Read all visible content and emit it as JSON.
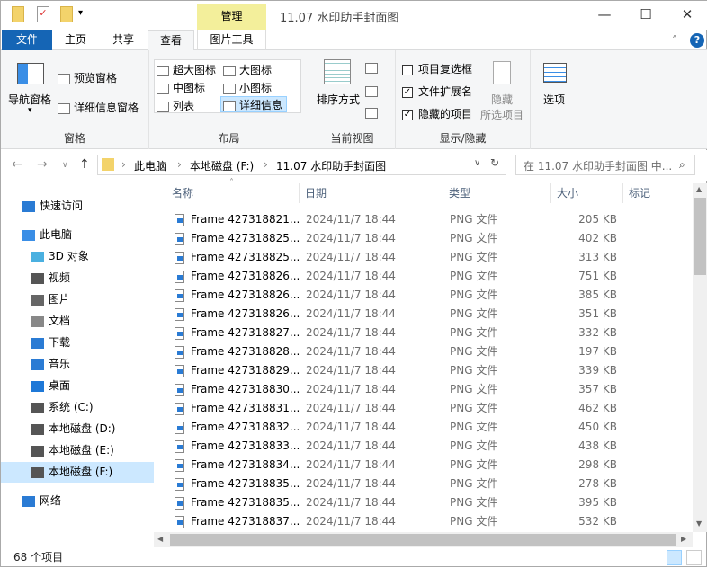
{
  "titlebar": {
    "title": "11.07 水印助手封面图",
    "context_tab": "管理",
    "minimize": "—",
    "maximize": "☐",
    "close": "✕"
  },
  "tabs": [
    {
      "label": "文件"
    },
    {
      "label": "主页"
    },
    {
      "label": "共享"
    },
    {
      "label": "查看"
    },
    {
      "label": "图片工具"
    }
  ],
  "ribbon": {
    "panes": {
      "nav_pane": "导航窗格",
      "preview": "预览窗格",
      "details": "详细信息窗格",
      "group": "窗格"
    },
    "layout": {
      "items": [
        "超大图标",
        "大图标",
        "中图标",
        "小图标",
        "列表",
        "详细信息"
      ],
      "group": "布局"
    },
    "view": {
      "sort": "排序方式",
      "group": "当前视图"
    },
    "show": {
      "item_checkbox": "项目复选框",
      "extensions": "文件扩展名",
      "hidden_items": "隐藏的项目",
      "hide_selected": "隐藏",
      "hide_selected2": "所选项目",
      "group": "显示/隐藏",
      "item_checkbox_checked": false,
      "extensions_checked": true,
      "hidden_checked": true
    },
    "options": "选项"
  },
  "address": {
    "crumbs": [
      "此电脑",
      "本地磁盘 (F:)",
      "11.07 水印助手封面图"
    ],
    "search_placeholder": "在 11.07 水印助手封面图 中..."
  },
  "sidebar": [
    {
      "label": "快速访问",
      "icon": "star-icon"
    },
    {
      "label": "此电脑",
      "icon": "computer-icon"
    },
    {
      "label": "3D 对象",
      "icon": "cube-icon"
    },
    {
      "label": "视频",
      "icon": "video-icon"
    },
    {
      "label": "图片",
      "icon": "picture-icon"
    },
    {
      "label": "文档",
      "icon": "document-icon"
    },
    {
      "label": "下载",
      "icon": "download-icon"
    },
    {
      "label": "音乐",
      "icon": "music-icon"
    },
    {
      "label": "桌面",
      "icon": "desktop-icon"
    },
    {
      "label": "系统 (C:)",
      "icon": "drive-icon"
    },
    {
      "label": "本地磁盘 (D:)",
      "icon": "drive-icon"
    },
    {
      "label": "本地磁盘 (E:)",
      "icon": "drive-icon"
    },
    {
      "label": "本地磁盘 (F:)",
      "icon": "drive-icon"
    },
    {
      "label": "网络",
      "icon": "network-icon"
    }
  ],
  "columns": [
    "名称",
    "日期",
    "类型",
    "大小",
    "标记"
  ],
  "files": [
    {
      "name": "Frame 427318821...",
      "date": "2024/11/7 18:44",
      "type": "PNG 文件",
      "size": "205 KB"
    },
    {
      "name": "Frame 427318825...",
      "date": "2024/11/7 18:44",
      "type": "PNG 文件",
      "size": "402 KB"
    },
    {
      "name": "Frame 427318825...",
      "date": "2024/11/7 18:44",
      "type": "PNG 文件",
      "size": "313 KB"
    },
    {
      "name": "Frame 427318826...",
      "date": "2024/11/7 18:44",
      "type": "PNG 文件",
      "size": "751 KB"
    },
    {
      "name": "Frame 427318826...",
      "date": "2024/11/7 18:44",
      "type": "PNG 文件",
      "size": "385 KB"
    },
    {
      "name": "Frame 427318826...",
      "date": "2024/11/7 18:44",
      "type": "PNG 文件",
      "size": "351 KB"
    },
    {
      "name": "Frame 427318827...",
      "date": "2024/11/7 18:44",
      "type": "PNG 文件",
      "size": "332 KB"
    },
    {
      "name": "Frame 427318828...",
      "date": "2024/11/7 18:44",
      "type": "PNG 文件",
      "size": "197 KB"
    },
    {
      "name": "Frame 427318829...",
      "date": "2024/11/7 18:44",
      "type": "PNG 文件",
      "size": "339 KB"
    },
    {
      "name": "Frame 427318830...",
      "date": "2024/11/7 18:44",
      "type": "PNG 文件",
      "size": "357 KB"
    },
    {
      "name": "Frame 427318831...",
      "date": "2024/11/7 18:44",
      "type": "PNG 文件",
      "size": "462 KB"
    },
    {
      "name": "Frame 427318832...",
      "date": "2024/11/7 18:44",
      "type": "PNG 文件",
      "size": "450 KB"
    },
    {
      "name": "Frame 427318833...",
      "date": "2024/11/7 18:44",
      "type": "PNG 文件",
      "size": "438 KB"
    },
    {
      "name": "Frame 427318834...",
      "date": "2024/11/7 18:44",
      "type": "PNG 文件",
      "size": "298 KB"
    },
    {
      "name": "Frame 427318835...",
      "date": "2024/11/7 18:44",
      "type": "PNG 文件",
      "size": "278 KB"
    },
    {
      "name": "Frame 427318835...",
      "date": "2024/11/7 18:44",
      "type": "PNG 文件",
      "size": "395 KB"
    },
    {
      "name": "Frame 427318837...",
      "date": "2024/11/7 18:44",
      "type": "PNG 文件",
      "size": "532 KB"
    }
  ],
  "status": {
    "count": "68 个项目"
  }
}
